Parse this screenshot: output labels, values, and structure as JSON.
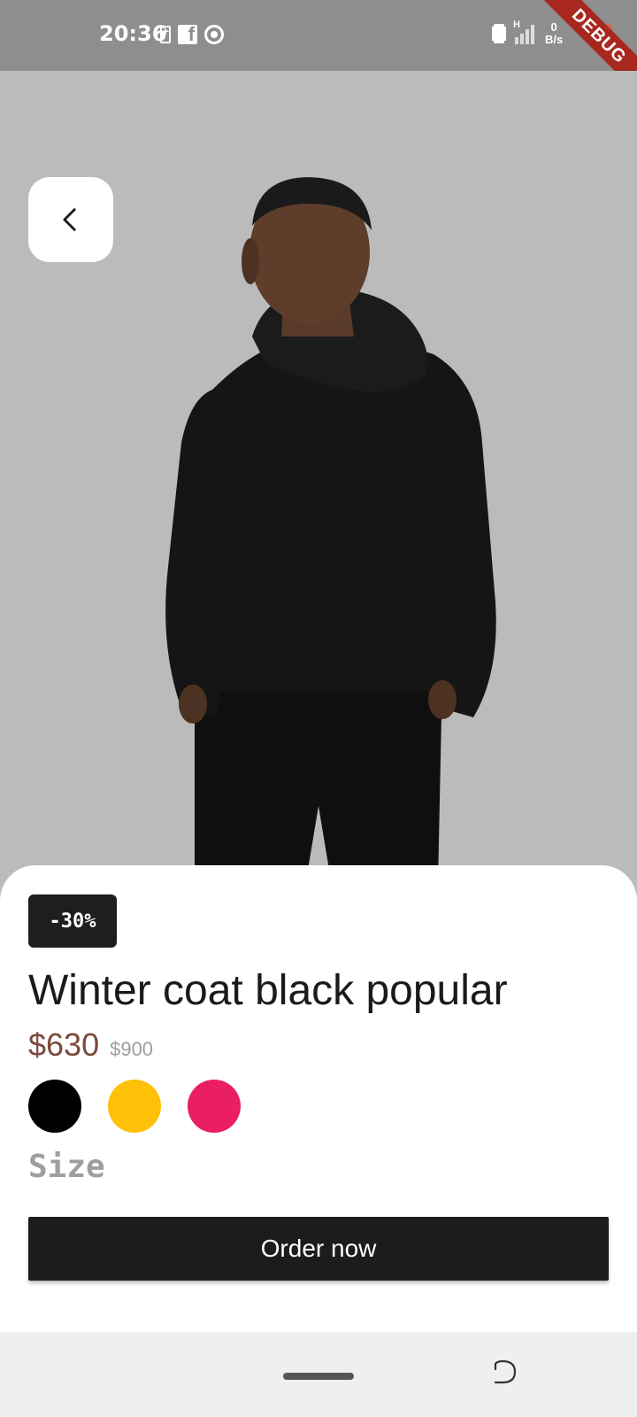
{
  "status_bar": {
    "time": "20:36",
    "net_speed_value": "0",
    "net_speed_unit": "B/s",
    "signal_label": "H",
    "debug_banner": "DEBUG",
    "left_icons": [
      "battery-saver-icon",
      "facebook-icon",
      "chrome-icon"
    ],
    "right_icons": [
      "vibrate-icon",
      "signal-icon",
      "battery-icon"
    ]
  },
  "hero": {
    "image": "model-back-view-black-hoodie"
  },
  "product": {
    "discount": "-30%",
    "title": "Winter coat black popular",
    "price": "$630",
    "old_price": "$900",
    "colors": [
      "#000000",
      "#FFC107",
      "#E91E63"
    ],
    "size_label": "Size",
    "order_label": "Order now"
  },
  "nav_bar": {
    "icons": [
      "home-handle",
      "rotate-icon"
    ]
  }
}
